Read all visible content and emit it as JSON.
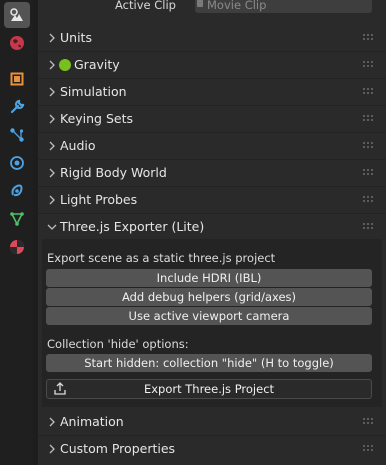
{
  "tabs": [
    {
      "icon": "scene-props-icon",
      "active": true
    },
    {
      "icon": "world-icon",
      "active": false
    },
    {
      "icon": "object-icon",
      "active": false
    },
    {
      "icon": "modifier-wrench-icon",
      "active": false
    },
    {
      "icon": "particles-icon",
      "active": false
    },
    {
      "icon": "physics-icon",
      "active": false
    },
    {
      "icon": "constraints-icon",
      "active": false
    },
    {
      "icon": "object-data-icon",
      "active": false
    },
    {
      "icon": "material-icon",
      "active": false
    }
  ],
  "header": {
    "active_clip_label": "Active Clip",
    "active_clip_placeholder": "Movie Clip"
  },
  "panels": {
    "units": "Units",
    "gravity": "Gravity",
    "simulation": "Simulation",
    "keying_sets": "Keying Sets",
    "audio": "Audio",
    "rigid_body_world": "Rigid Body World",
    "light_probes": "Light Probes",
    "threejs_exporter": "Three.js Exporter (Lite)",
    "animation": "Animation",
    "custom_properties": "Custom Properties"
  },
  "exporter": {
    "section_label": "Export scene as a static three.js project",
    "include_hdri": "Include HDRI (IBL)",
    "debug_helpers": "Add debug helpers (grid/axes)",
    "active_camera": "Use active viewport camera",
    "collection_options_label": "Collection 'hide' options:",
    "start_hidden": "Start hidden: collection \"hide\" (H to toggle)",
    "export_button": "Export Three.js Project"
  },
  "colors": {
    "gravity_enabled": "#78c01e",
    "button_bg": "#545454",
    "panel_bg": "#2a2a2a",
    "active_tab_bg": "#545454"
  }
}
